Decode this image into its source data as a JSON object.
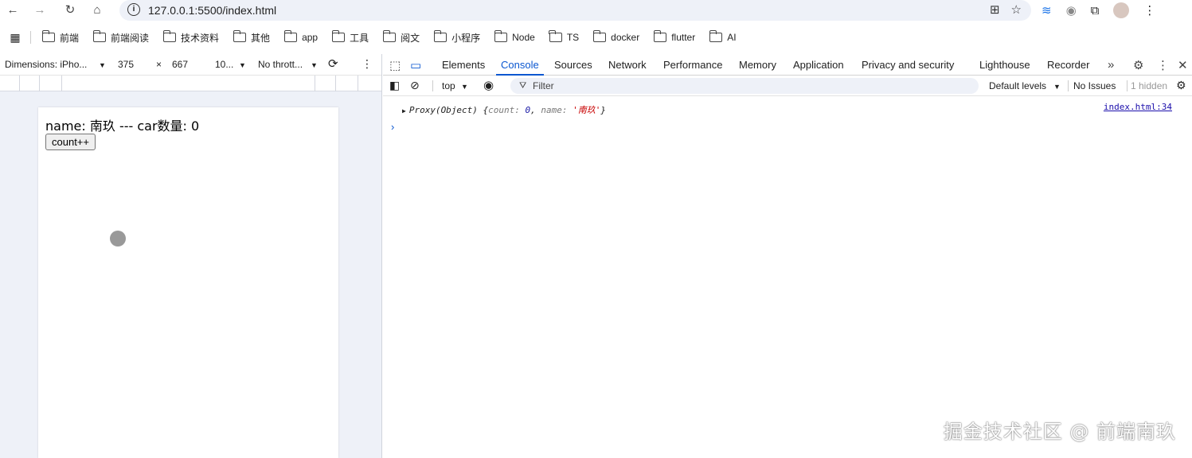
{
  "browser": {
    "url": "127.0.0.1:5500/index.html",
    "bookmarks": [
      "前端",
      "前端阅读",
      "技术资料",
      "其他",
      "app",
      "工具",
      "阅文",
      "小程序",
      "Node",
      "TS",
      "docker",
      "flutter",
      "AI"
    ]
  },
  "device_toolbar": {
    "dimensions": "Dimensions: iPho...",
    "width": "375",
    "times": "×",
    "height": "667",
    "zoom": "10...",
    "throttle": "No thrott..."
  },
  "page": {
    "text": "name: 南玖 --- car数量: 0",
    "button": "count++"
  },
  "devtools": {
    "tabs": [
      "Elements",
      "Console",
      "Sources",
      "Network",
      "Performance",
      "Memory",
      "Application",
      "Privacy and security",
      "Lighthouse",
      "Recorder"
    ],
    "active_tab": "Console",
    "context": "top",
    "filter_placeholder": "Filter",
    "levels": "Default levels",
    "issues": "No Issues",
    "hidden": "1 hidden",
    "log": {
      "prefix": "Proxy(Object) {",
      "k1": "count",
      "v1": "0",
      "k2": "name",
      "v2": "'南玖'",
      "suffix": "}",
      "source": "index.html:34"
    }
  },
  "watermark": "掘金技术社区 @ 前端南玖"
}
